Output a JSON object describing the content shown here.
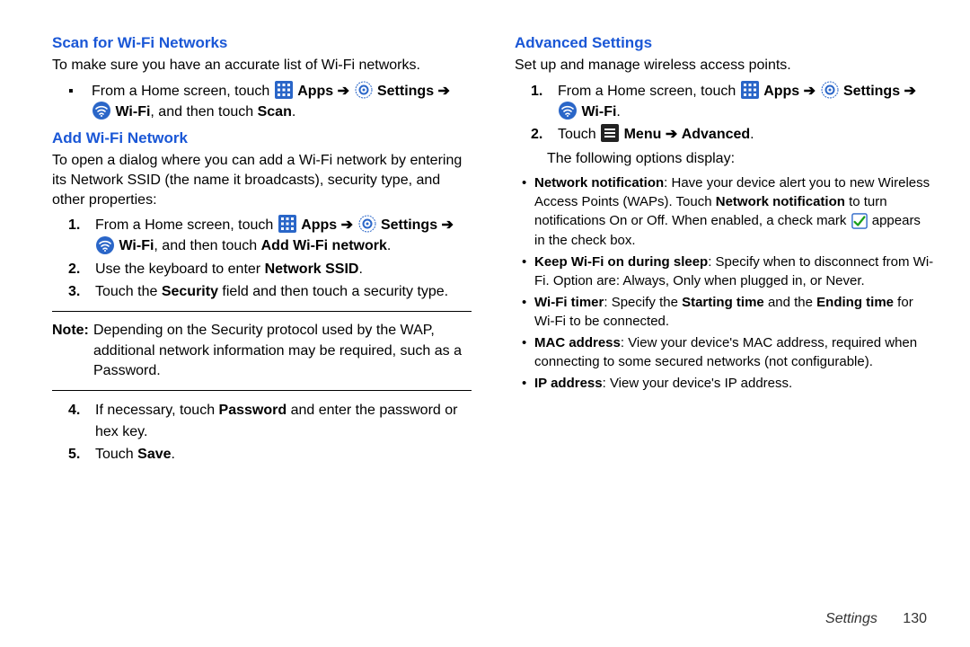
{
  "left": {
    "h_scan": "Scan for Wi-Fi Networks",
    "p_scan": "To make sure you have an accurate list of Wi-Fi networks.",
    "scan_step_pre": "From a Home screen, touch ",
    "apps": "Apps",
    "arrow": "➔",
    "settings": "Settings",
    "wifi": "Wi-Fi",
    "scan_tail": ", and then touch ",
    "scan_bold": "Scan",
    "h_add": "Add Wi-Fi Network",
    "p_add": "To open a dialog where you can add a Wi-Fi network by entering its Network SSID (the name it broadcasts), security type, and other properties:",
    "add1_pre": "From a Home screen, touch ",
    "add1_tail": ", and then touch ",
    "add1_bold": "Add Wi-Fi network",
    "add2_pre": "Use the keyboard to enter ",
    "add2_bold": "Network SSID",
    "add3_a": "Touch the ",
    "add3_b": "Security",
    "add3_c": " field and then touch a security type.",
    "note_label": "Note:",
    "note_text": "Depending on the Security protocol used by the WAP, additional network information may be required, such as a Password.",
    "add4_a": "If necessary, touch ",
    "add4_b": "Password",
    "add4_c": " and enter the password or hex key.",
    "add5_a": "Touch ",
    "add5_b": "Save"
  },
  "right": {
    "h_adv": "Advanced Settings",
    "p_adv": "Set up and manage wireless access points.",
    "step1_pre": "From a Home screen, touch ",
    "apps": "Apps",
    "arrow": "➔",
    "settings": "Settings",
    "wifi": "Wi-Fi",
    "step2_a": "Touch ",
    "step2_b": "Menu",
    "step2_c": "Advanced",
    "p_follow": "The following options display:",
    "b1_t": "Network notification",
    "b1_a": ": Have your device alert you to new Wireless Access Points (WAPs). Touch ",
    "b1_b": "Network notification",
    "b1_c": " to turn notifications On or Off. When enabled, a check mark ",
    "b1_d": " appears in the check box.",
    "b2_t": "Keep Wi-Fi on during sleep",
    "b2_a": ": Specify when to disconnect from Wi-Fi. Option are: Always, Only when plugged in, or Never.",
    "b3_t": "Wi-Fi timer",
    "b3_a": ": Specify the ",
    "b3_b": "Starting time",
    "b3_c": " and the ",
    "b3_d": "Ending time",
    "b3_e": " for Wi-Fi to be connected.",
    "b4_t": "MAC address",
    "b4_a": ": View your device's MAC address, required when connecting to some secured networks (not configurable).",
    "b5_t": "IP address",
    "b5_a": ": View your device's IP address."
  },
  "footer": {
    "section": "Settings",
    "page": "130"
  }
}
